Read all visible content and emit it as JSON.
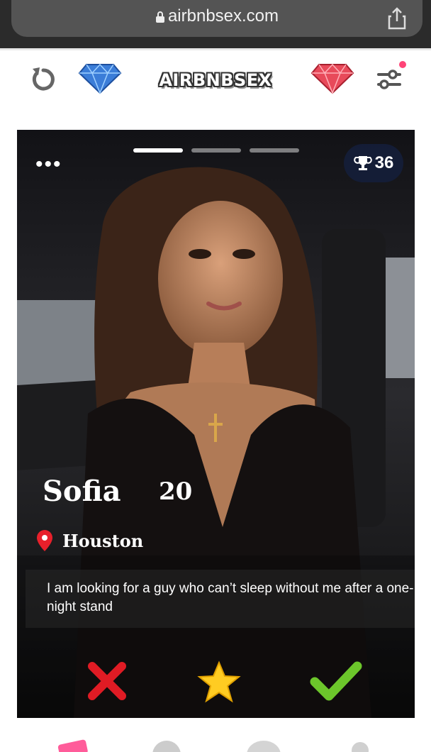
{
  "browser": {
    "url": "airbnbsex.com"
  },
  "appbar": {
    "brand": "AIRBNBSEX"
  },
  "profile": {
    "name": "Sofia",
    "age": "20",
    "location": "Houston",
    "bio": "I am looking for a guy who can’t sleep without me after a one-night stand",
    "trophy_count": "36",
    "photo_index": 1,
    "photo_total": 3
  },
  "colors": {
    "like": "#6cc62b",
    "dislike": "#e01b24",
    "superlike": "#ffcc22",
    "pin": "#e8202b"
  }
}
